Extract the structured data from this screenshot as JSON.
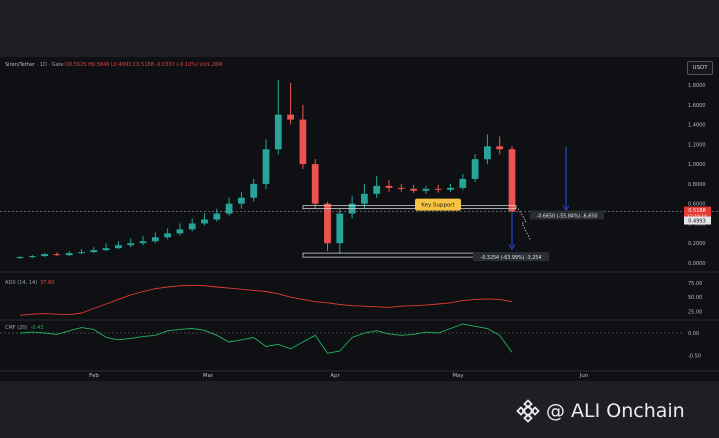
{
  "header": {
    "symbol": "Siren/Tether",
    "interval": "1D",
    "exchange": "Gate",
    "ohlc": "O0.5525 H0.5840 L0.4993 C0.5188 -0.0337 (-6.10%) Vol1.26M"
  },
  "currency": "USDT",
  "price_axis": {
    "ticks": [
      "1.8000",
      "1.6000",
      "1.4000",
      "1.2000",
      "1.0000",
      "0.8000",
      "0.6000",
      "0.4000",
      "0.2000",
      "0.0000"
    ],
    "current_price": "0.5188",
    "countdown": "12:16:10",
    "support_price": "0.4993",
    "current_color": "#e53935"
  },
  "time_axis": {
    "labels": [
      "Feb",
      "Mar",
      "Apr",
      "May",
      "Jun"
    ]
  },
  "annotations": {
    "key_support": "Key Support",
    "measure_upper": "-0.6650 (-55.84%) -6,650",
    "measure_lower": "-0.3254 (-63.99%) -3,254",
    "support_color": "#f6c342",
    "arrow_color": "#2346c8"
  },
  "adx_pane": {
    "label": "ADX (14, 14)",
    "value": "37.80",
    "ticks": [
      "75.00",
      "50.00",
      "25.00"
    ],
    "color": "#e53935"
  },
  "cmf_pane": {
    "label": "CMF (20)",
    "value": "-0.43",
    "ticks": [
      "0.00",
      "-0.50"
    ],
    "color": "#22b35a"
  },
  "watermark": {
    "text": "@ ALI Onchain",
    "icon": "binance-diamond-icon"
  },
  "chart_data": {
    "type": "candlestick",
    "ylim": [
      0,
      1.85
    ],
    "up_color": "#26a69a",
    "down_color": "#ef5350",
    "x": [
      "Jan 16",
      "Jan 19",
      "Jan 22",
      "Jan 25",
      "Jan 28",
      "Jan 31",
      "Feb 3",
      "Feb 6",
      "Feb 9",
      "Feb 12",
      "Feb 15",
      "Feb 18",
      "Feb 21",
      "Feb 24",
      "Feb 27",
      "Mar 2",
      "Mar 5",
      "Mar 8",
      "Mar 11",
      "Mar 14",
      "Mar 17",
      "Mar 20",
      "Mar 23",
      "Mar 26",
      "Mar 29",
      "Apr 1",
      "Apr 4",
      "Apr 7",
      "Apr 10",
      "Apr 13",
      "Apr 16",
      "Apr 19",
      "Apr 22",
      "Apr 25",
      "Apr 28",
      "May 1",
      "May 4",
      "May 7",
      "May 10",
      "May 13",
      "May 16"
    ],
    "open": [
      0.05,
      0.06,
      0.07,
      0.09,
      0.08,
      0.1,
      0.11,
      0.13,
      0.15,
      0.18,
      0.2,
      0.22,
      0.26,
      0.3,
      0.34,
      0.4,
      0.44,
      0.5,
      0.6,
      0.66,
      0.8,
      1.15,
      1.5,
      1.45,
      1.0,
      0.6,
      0.2,
      0.5,
      0.6,
      0.7,
      0.78,
      0.76,
      0.75,
      0.73,
      0.75,
      0.74,
      0.76,
      0.85,
      1.05,
      1.18,
      1.15
    ],
    "high": [
      0.07,
      0.08,
      0.1,
      0.11,
      0.12,
      0.14,
      0.16,
      0.2,
      0.22,
      0.25,
      0.27,
      0.31,
      0.35,
      0.4,
      0.45,
      0.5,
      0.55,
      0.66,
      0.72,
      0.85,
      1.25,
      1.85,
      1.82,
      1.6,
      1.05,
      0.62,
      0.55,
      0.68,
      0.8,
      0.88,
      0.84,
      0.8,
      0.79,
      0.78,
      0.79,
      0.8,
      0.9,
      1.1,
      1.3,
      1.28,
      1.18
    ],
    "low": [
      0.04,
      0.05,
      0.06,
      0.07,
      0.07,
      0.09,
      0.1,
      0.12,
      0.14,
      0.16,
      0.18,
      0.2,
      0.24,
      0.28,
      0.32,
      0.38,
      0.42,
      0.48,
      0.55,
      0.62,
      0.75,
      1.1,
      1.4,
      0.95,
      0.55,
      0.12,
      0.1,
      0.45,
      0.55,
      0.66,
      0.72,
      0.72,
      0.71,
      0.7,
      0.71,
      0.72,
      0.74,
      0.82,
      1.0,
      1.1,
      0.5
    ],
    "close": [
      0.06,
      0.07,
      0.09,
      0.08,
      0.1,
      0.11,
      0.13,
      0.15,
      0.18,
      0.2,
      0.22,
      0.26,
      0.3,
      0.34,
      0.4,
      0.44,
      0.5,
      0.6,
      0.66,
      0.8,
      1.15,
      1.5,
      1.45,
      1.0,
      0.6,
      0.2,
      0.5,
      0.6,
      0.7,
      0.78,
      0.76,
      0.75,
      0.73,
      0.75,
      0.74,
      0.76,
      0.85,
      1.05,
      1.18,
      1.15,
      0.52
    ],
    "adx": [
      18,
      20,
      21,
      20,
      19,
      22,
      30,
      38,
      46,
      54,
      60,
      65,
      68,
      70,
      71,
      70,
      68,
      66,
      64,
      62,
      60,
      56,
      50,
      46,
      42,
      40,
      37,
      35,
      34,
      33,
      32,
      34,
      35,
      36,
      38,
      40,
      44,
      46,
      47,
      46,
      42
    ],
    "cmf": [
      0.0,
      0.02,
      0.0,
      -0.03,
      0.05,
      0.12,
      0.08,
      -0.1,
      -0.15,
      -0.12,
      -0.08,
      -0.05,
      0.05,
      0.08,
      0.1,
      0.06,
      -0.05,
      -0.2,
      -0.15,
      -0.1,
      -0.3,
      -0.25,
      -0.35,
      -0.2,
      -0.05,
      -0.45,
      -0.4,
      -0.1,
      0.0,
      0.05,
      -0.02,
      -0.05,
      -0.03,
      0.02,
      0.0,
      0.1,
      0.2,
      0.15,
      0.1,
      -0.05,
      -0.43
    ]
  }
}
